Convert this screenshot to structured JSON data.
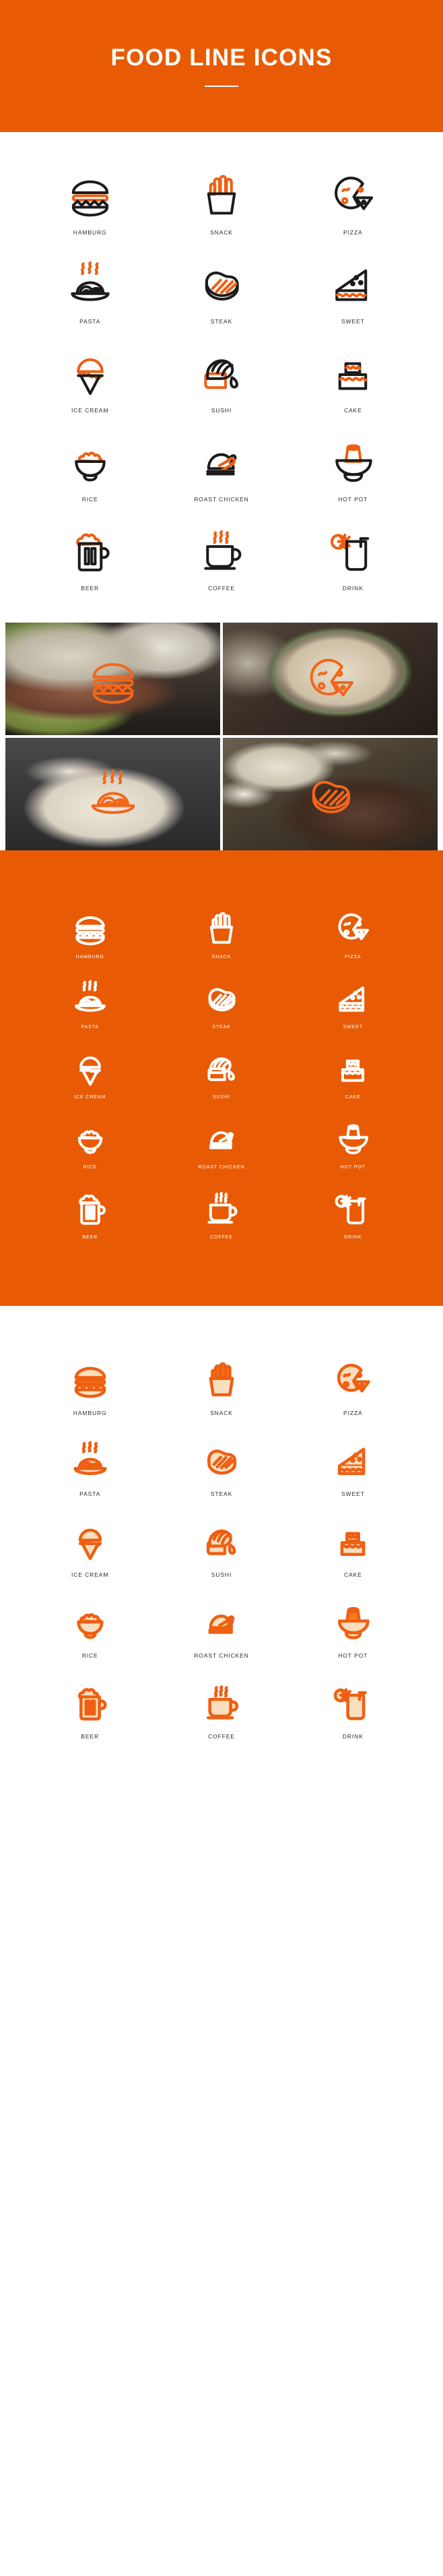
{
  "header": {
    "title": "FOOD LINE ICONS",
    "brand_orange": "#e85b04",
    "accent_orange": "#ef5f12",
    "soft_fill": "#fadfbe"
  },
  "icon_set": [
    {
      "id": "hamburg",
      "label": "HAMBURG",
      "icon": "hamburger-icon"
    },
    {
      "id": "snack",
      "label": "SNACK",
      "icon": "french-fries-icon"
    },
    {
      "id": "pizza",
      "label": "PIZZA",
      "icon": "pizza-icon"
    },
    {
      "id": "pasta",
      "label": "PASTA",
      "icon": "pasta-icon"
    },
    {
      "id": "steak",
      "label": "STEAK",
      "icon": "steak-icon"
    },
    {
      "id": "sweet",
      "label": "SWEET",
      "icon": "cake-slice-icon"
    },
    {
      "id": "ice-cream",
      "label": "ICE CREAM",
      "icon": "ice-cream-cone-icon"
    },
    {
      "id": "sushi",
      "label": "SUSHI",
      "icon": "sushi-icon"
    },
    {
      "id": "cake",
      "label": "CAKE",
      "icon": "tiered-cake-icon"
    },
    {
      "id": "rice",
      "label": "RICE",
      "icon": "rice-bowl-icon"
    },
    {
      "id": "roast-chicken",
      "label": "ROAST CHICKEN",
      "icon": "roast-chicken-icon"
    },
    {
      "id": "hot-pot",
      "label": "HOT POT",
      "icon": "hot-pot-icon"
    },
    {
      "id": "beer",
      "label": "BEER",
      "icon": "beer-mug-icon"
    },
    {
      "id": "coffee",
      "label": "COFFEE",
      "icon": "coffee-cup-icon"
    },
    {
      "id": "drink",
      "label": "DRINK",
      "icon": "soft-drink-glass-icon"
    }
  ],
  "sections": [
    {
      "id": "outline-dark",
      "style": "black and orange outline on white"
    },
    {
      "id": "photo-grid",
      "style": "photo thumbnails with orange icon overlay"
    },
    {
      "id": "outline-white",
      "style": "white outline on orange"
    },
    {
      "id": "filled",
      "style": "orange outline with peach fill on white"
    }
  ],
  "photo_grid": [
    {
      "id": "photo-hamburg",
      "overlay_icon": "hamburger-icon",
      "subject": "hamburger"
    },
    {
      "id": "photo-pizza",
      "overlay_icon": "pizza-icon",
      "subject": "pizza"
    },
    {
      "id": "photo-pasta",
      "overlay_icon": "pasta-icon",
      "subject": "pasta"
    },
    {
      "id": "photo-steak",
      "overlay_icon": "steak-icon",
      "subject": "steak"
    }
  ]
}
